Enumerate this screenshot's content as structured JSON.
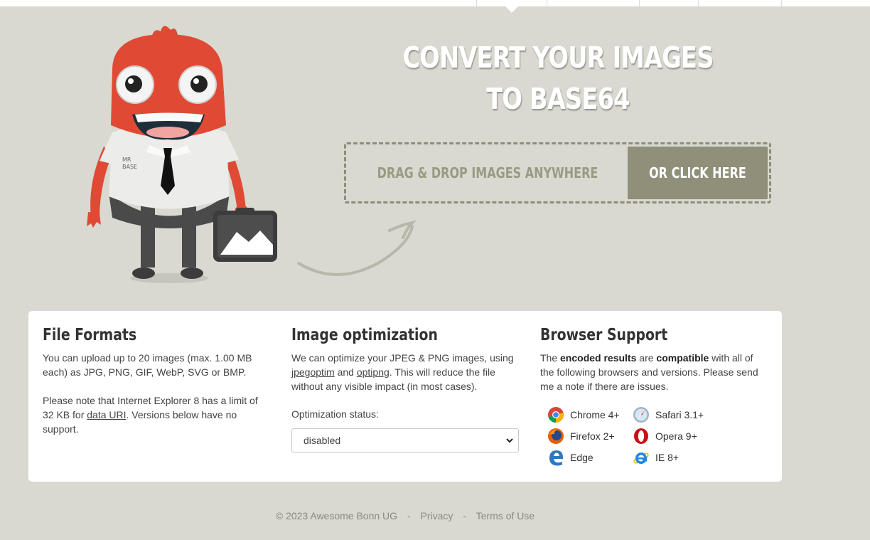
{
  "hero": {
    "title_line1": "CONVERT YOUR IMAGES",
    "title_line2": "TO BASE64",
    "drop_text": "DRAG & DROP IMAGES ANYWHERE",
    "click_label": "OR CLICK HERE"
  },
  "mascot": {
    "shirt_text_line1": "MR",
    "shirt_text_line2": "BASE"
  },
  "formats": {
    "title": "File Formats",
    "p1": "You can upload up to 20 images (max. 1.00 MB each) as JPG, PNG, GIF, WebP, SVG or BMP.",
    "p2_before": "Please note that Internet Explorer 8 has a limit of 32 KB for ",
    "p2_link": "data URI",
    "p2_after": ". Versions below have no support."
  },
  "optimization": {
    "title": "Image optimization",
    "text_before": "We can optimize your JPEG & PNG images, using ",
    "link1": "jpegoptim",
    "text_mid": " and ",
    "link2": "optipng",
    "text_after": ". This will reduce the file without any visible impact (in most cases).",
    "status_label": "Optimization status:",
    "status_value": "disabled"
  },
  "support": {
    "title": "Browser Support",
    "text_1": "The ",
    "bold_1": "encoded results",
    "text_2": " are ",
    "bold_2": "compatible",
    "text_3": " with all of the following browsers and versions. Please send me a note if there are issues.",
    "browsers": [
      {
        "name": "Chrome 4+",
        "icon": "chrome-icon"
      },
      {
        "name": "Safari 3.1+",
        "icon": "safari-icon"
      },
      {
        "name": "Firefox 2+",
        "icon": "firefox-icon"
      },
      {
        "name": "Opera 9+",
        "icon": "opera-icon"
      },
      {
        "name": "Edge",
        "icon": "edge-icon"
      },
      {
        "name": "IE 8+",
        "icon": "ie-icon"
      }
    ]
  },
  "footer": {
    "copyright": "© 2023 Awesome Bonn UG",
    "separator": "-",
    "privacy": "Privacy",
    "terms": "Terms of Use"
  },
  "colors": {
    "background": "#d9d9d1",
    "accent_button": "#8f8f7a",
    "mascot_red": "#e04a35"
  }
}
